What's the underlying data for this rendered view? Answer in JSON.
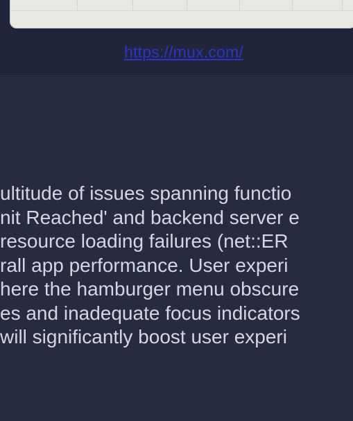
{
  "screenshot": {
    "url": "https://mux.com/"
  },
  "summary": {
    "lines": [
      "ultitude of issues spanning functio",
      "nit Reached' and backend server e",
      "resource loading failures (net::ER",
      "rall app performance. User experi",
      "here the hamburger menu obscure",
      "es and inadequate focus indicators",
      "will significantly boost user experi"
    ]
  },
  "colors": {
    "background": "#262b40",
    "header_band": "#20253a",
    "link": "#2a36c9",
    "text": "#d4d7e0"
  }
}
